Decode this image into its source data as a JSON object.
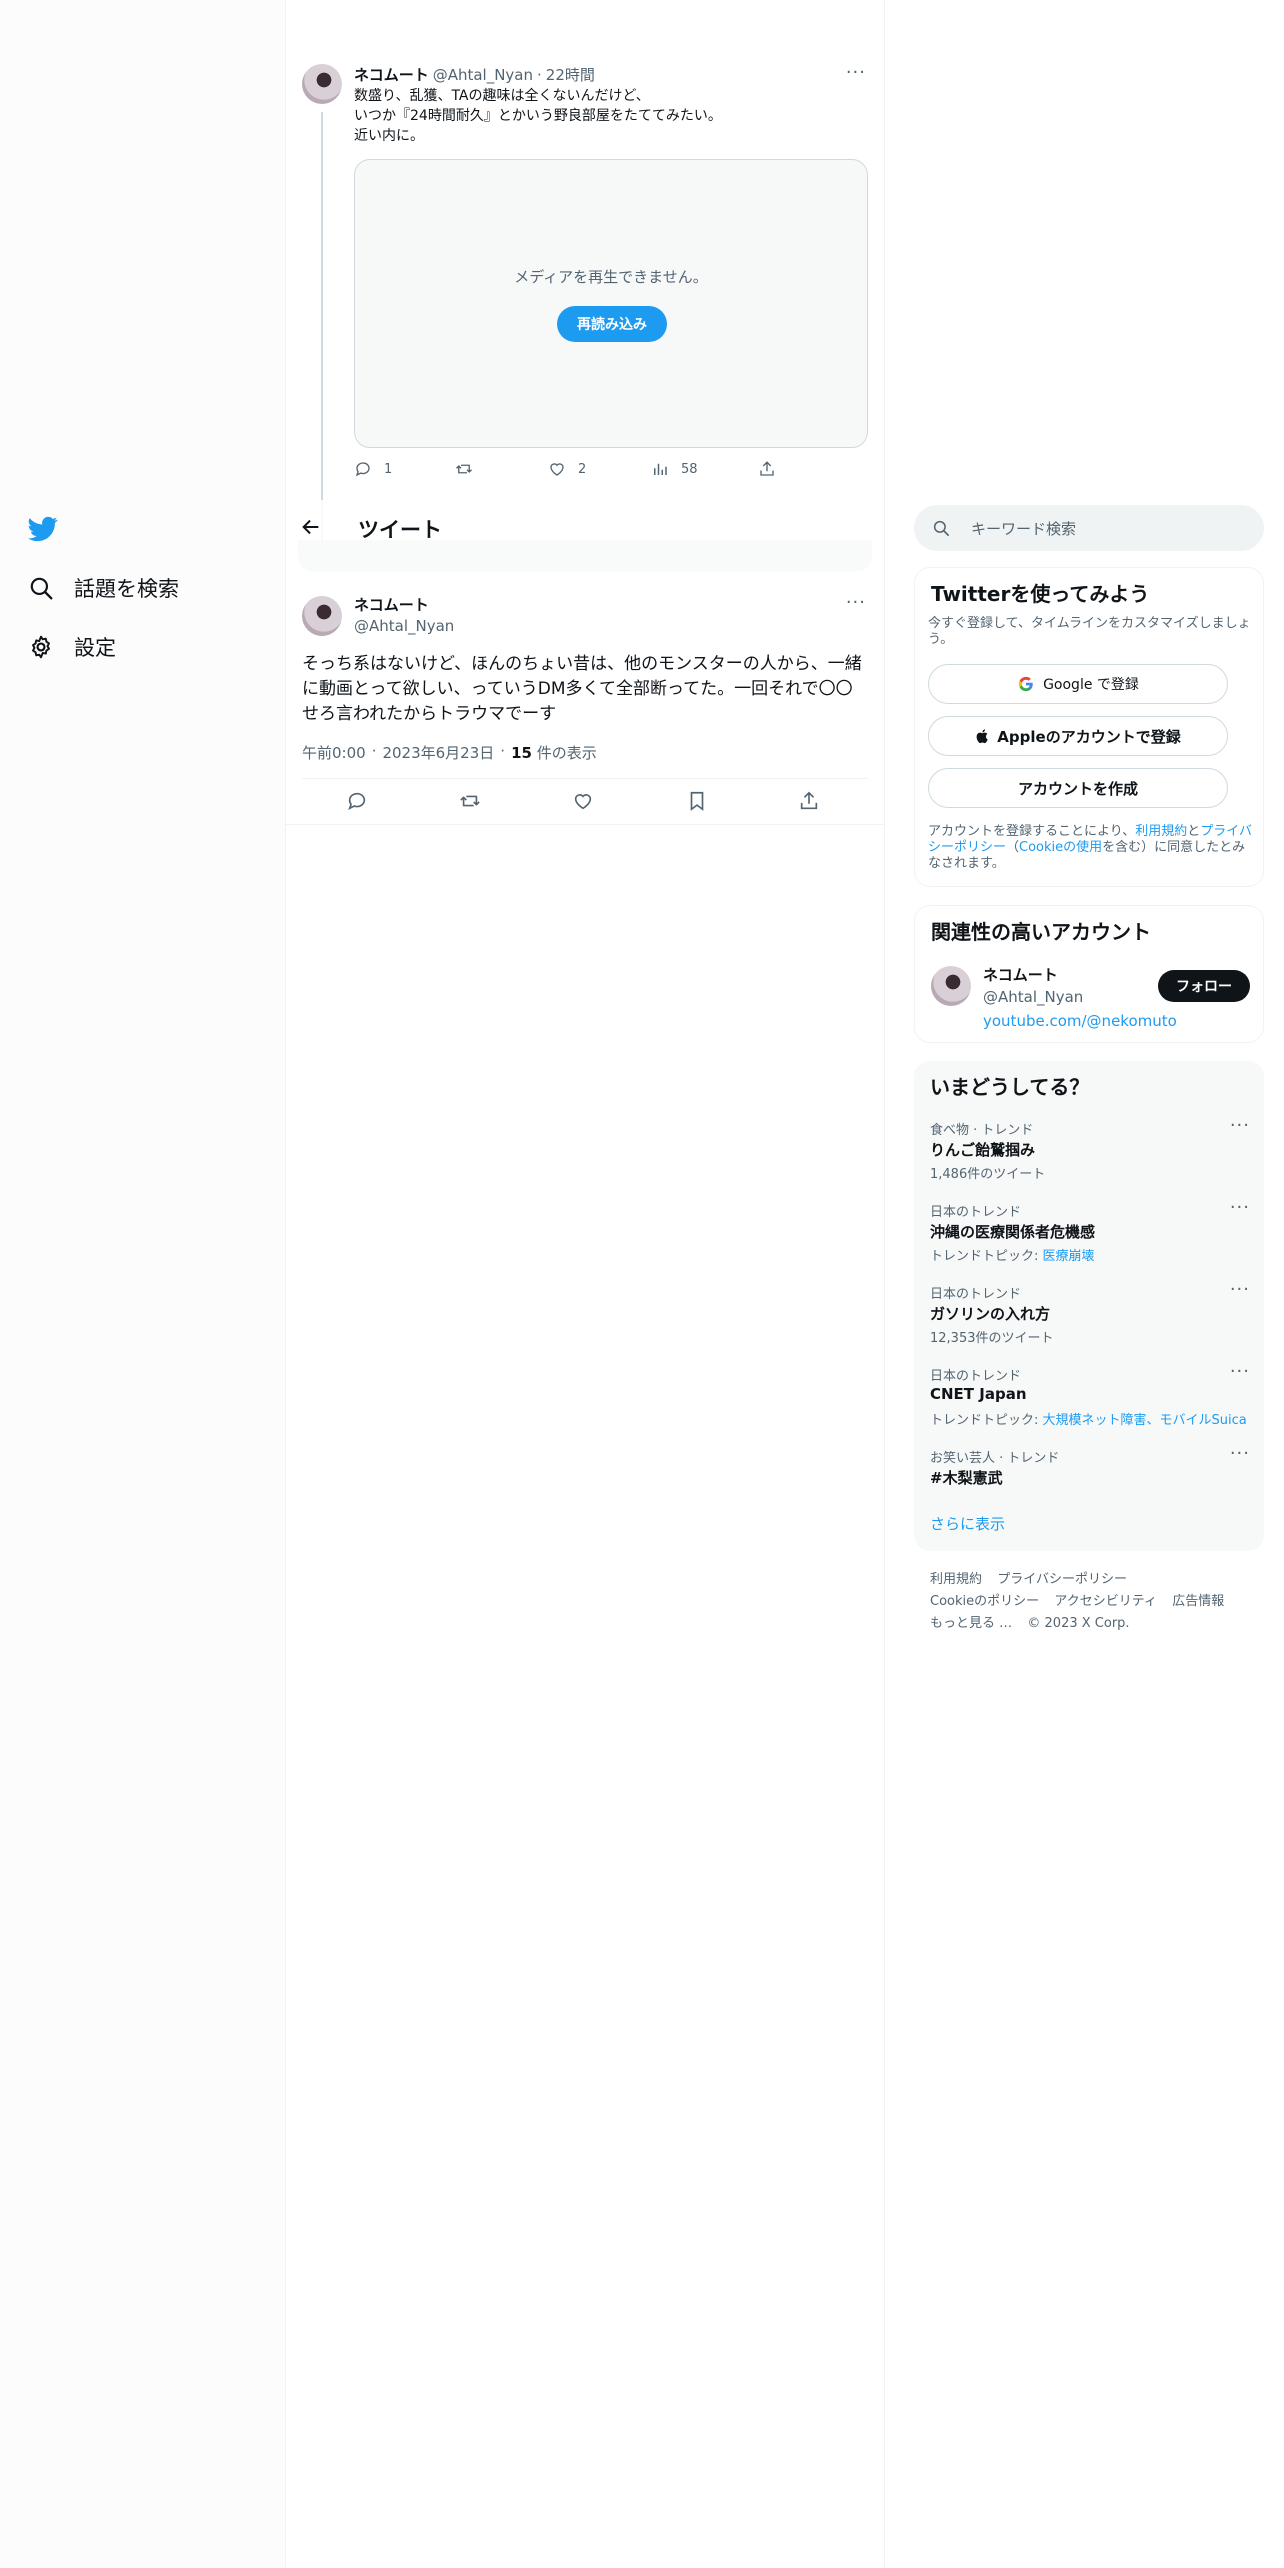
{
  "nav": {
    "items": [
      {
        "label": "話題を検索",
        "icon": "search-icon"
      },
      {
        "label": "設定",
        "icon": "gear-icon"
      }
    ],
    "logo": "twitter-bird-icon"
  },
  "header": {
    "title": "ツイート",
    "back_icon": "back-arrow-icon"
  },
  "parent_tweet": {
    "name": "ネコムート",
    "handle": "@Ahtal_Nyan",
    "sep": "·",
    "time": "22時間",
    "text": "数盛り、乱獲、TAの趣味は全くないんだけど、\nいつか『24時間耐久』とかいう野良部屋をたててみたい。\n近い内に。",
    "media_error": "メディアを再生できません。",
    "reload_label": "再読み込み",
    "replies": "1",
    "likes": "2",
    "views": "58"
  },
  "main_tweet": {
    "name": "ネコムート",
    "handle": "@Ahtal_Nyan",
    "text": "そっち系はないけど、ほんのちょい昔は、他のモンスターの人から、一緒に動画とって欲しい、っていうDM多くて全部断ってた。一回それで〇〇せろ言われたからトラウマでーす",
    "time": "午前0:00",
    "date": "2023年6月23日",
    "views_count": "15",
    "views_label": "件の表示"
  },
  "search": {
    "placeholder": "キーワード検索"
  },
  "signup": {
    "title": "Twitterを使ってみよう",
    "subtitle": "今すぐ登録して、タイムラインをカスタマイズしましょう。",
    "google_label": "Google で登録",
    "apple_label": "Appleのアカウントで登録",
    "create_label": "アカウントを作成",
    "terms_pre": "アカウントを登録することにより、",
    "terms_link": "利用規約",
    "terms_and": "と",
    "privacy_link": "プライバシーポリシー",
    "cookie_pre": "（",
    "cookie_link": "Cookieの使用",
    "terms_post": "を含む）に同意したとみなされます。"
  },
  "relevant": {
    "title": "関連性の高いアカウント",
    "name": "ネコムート",
    "handle": "@Ahtal_Nyan",
    "url": "youtube.com/@nekomuto",
    "follow_label": "フォロー"
  },
  "trends": {
    "title": "いまどうしてる？",
    "items": [
      {
        "category": "食べ物 · トレンド",
        "name": "りんご飴鷲掴み",
        "sub": "1,486件のツイート",
        "link": ""
      },
      {
        "category": "日本のトレンド",
        "name": "沖縄の医療関係者危機感",
        "sub": "トレンドトピック: ",
        "link": "医療崩壊"
      },
      {
        "category": "日本のトレンド",
        "name": "ガソリンの入れ方",
        "sub": "12,353件のツイート",
        "link": ""
      },
      {
        "category": "日本のトレンド",
        "name": "CNET Japan",
        "sub": "トレンドトピック: ",
        "link": "大規模ネット障害、モバイルSuica"
      },
      {
        "category": "お笑い芸人 · トレンド",
        "name": "#木梨憲武",
        "sub": "",
        "link": ""
      }
    ],
    "show_more": "さらに表示"
  },
  "footer": {
    "links": [
      "利用規約",
      "プライバシーポリシー",
      "Cookieのポリシー",
      "アクセシビリティ",
      "広告情報",
      "もっと見る …"
    ],
    "copyright": "© 2023 X Corp."
  },
  "colors": {
    "accent": "#1d9bf0",
    "text": "#0f1419",
    "muted": "#536471",
    "border": "#eff3f4"
  }
}
